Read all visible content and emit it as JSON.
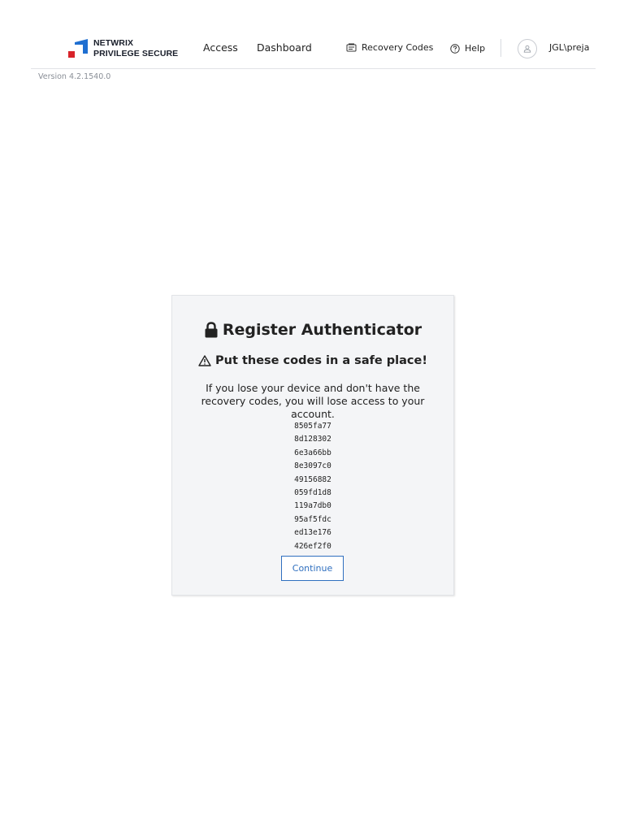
{
  "brand": {
    "line1": "NETWRIX",
    "line2": "PRIVILEGE SECURE",
    "colors": {
      "blue": "#1f6fd1",
      "red": "#d8232a"
    }
  },
  "nav": {
    "access": "Access",
    "dashboard": "Dashboard"
  },
  "utilities": {
    "recovery_codes": "Recovery Codes",
    "help": "Help",
    "username": "JGL\\preja"
  },
  "version": "Version 4.2.1540.0",
  "dialog": {
    "title": "Register Authenticator",
    "title_icon": "lock-icon",
    "subtitle": "Put these codes in a safe place!",
    "subtitle_icon": "warning-icon",
    "message": "If you lose your device and don't have the recovery codes, you will lose access to your account.",
    "codes": [
      "8505fa77",
      "8d128302",
      "6e3a66bb",
      "8e3097c0",
      "49156882",
      "059fd1d8",
      "119a7db0",
      "95af5fdc",
      "ed13e176",
      "426ef2f0"
    ],
    "continue_label": "Continue"
  },
  "colors": {
    "accent": "#2f6fbf",
    "card_bg": "#f4f5f7"
  }
}
